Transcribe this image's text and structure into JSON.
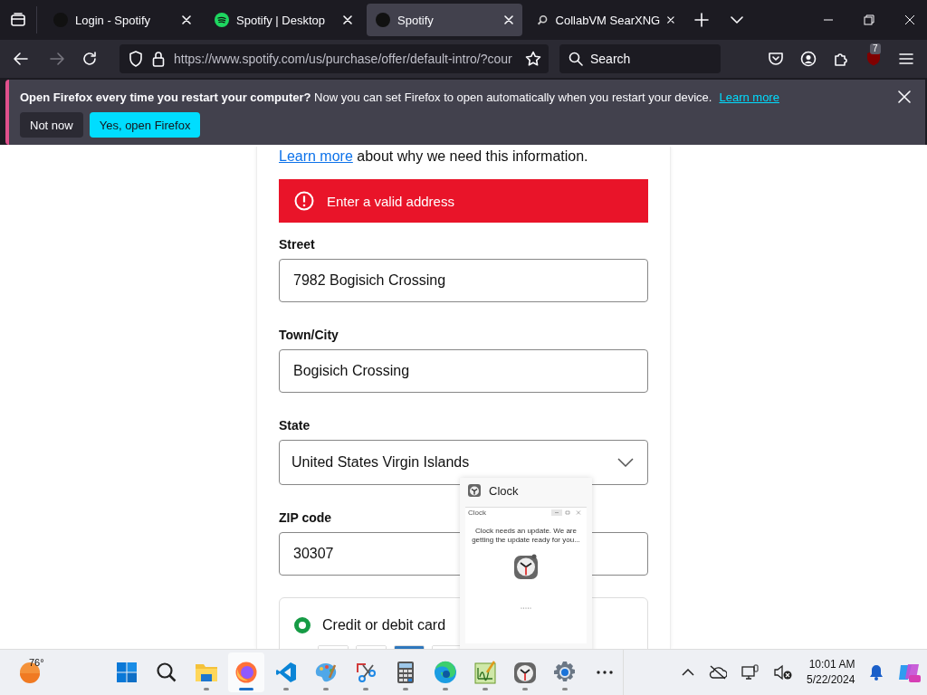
{
  "browser": {
    "tabs": [
      {
        "title": "Login - Spotify",
        "kind": "dark",
        "selected": false
      },
      {
        "title": "Spotify | Desktop",
        "kind": "spotify",
        "selected": false
      },
      {
        "title": "Spotify",
        "kind": "dark",
        "selected": true
      },
      {
        "title": "CollabVM SearXNG",
        "kind": "searx",
        "selected": false
      }
    ],
    "url": "https://www.spotify.com/us/purchase/offer/default-intro/?cour",
    "search_placeholder": "Search",
    "extension_badge": "7"
  },
  "notification": {
    "message": "**Open Firefox every time you restart your computer?** Now you can set Firefox to open automatically when you restart your device.",
    "link": "Learn more",
    "buttons": [
      {
        "label": "Not now",
        "kind": "secondary"
      },
      {
        "label": "Yes, open Firefox",
        "kind": "primary"
      }
    ]
  },
  "form": {
    "intro_link": "Learn more",
    "intro_text": "about why we need this information.",
    "error": "Enter a valid address",
    "fields": [
      {
        "label": "Street",
        "value": "7982 Bogisich Crossing",
        "kind": "text"
      },
      {
        "label": "Town/City",
        "value": "Bogisich Crossing",
        "kind": "text"
      },
      {
        "label": "State",
        "value": "United States Virgin Islands",
        "kind": "select"
      },
      {
        "label": "ZIP code",
        "value": "30307",
        "kind": "text"
      }
    ],
    "payment_option": {
      "label": "Credit or debit card",
      "checked": true
    }
  },
  "clock_preview": {
    "title": "Clock",
    "window_title": "Clock",
    "message": "Clock needs an update. We are getting the update ready for you..."
  },
  "taskbar": {
    "weather": "76°",
    "apps": [
      {
        "kind": "start",
        "open": false,
        "selected": false
      },
      {
        "kind": "search",
        "open": false,
        "selected": false
      },
      {
        "kind": "folder",
        "open": true,
        "selected": false
      },
      {
        "kind": "firefox",
        "open": true,
        "selected": true
      },
      {
        "kind": "vscode",
        "open": true,
        "selected": false
      },
      {
        "kind": "paint",
        "open": true,
        "selected": false
      },
      {
        "kind": "snip",
        "open": true,
        "selected": false
      },
      {
        "kind": "calculator",
        "open": true,
        "selected": false
      },
      {
        "kind": "edge",
        "open": true,
        "selected": false
      },
      {
        "kind": "chart",
        "open": true,
        "selected": false
      },
      {
        "kind": "clock",
        "open": true,
        "selected": false
      },
      {
        "kind": "settings",
        "open": true,
        "selected": false
      },
      {
        "kind": "more",
        "open": false,
        "selected": false
      }
    ],
    "time": "10:01 AM",
    "date": "5/22/2024"
  }
}
